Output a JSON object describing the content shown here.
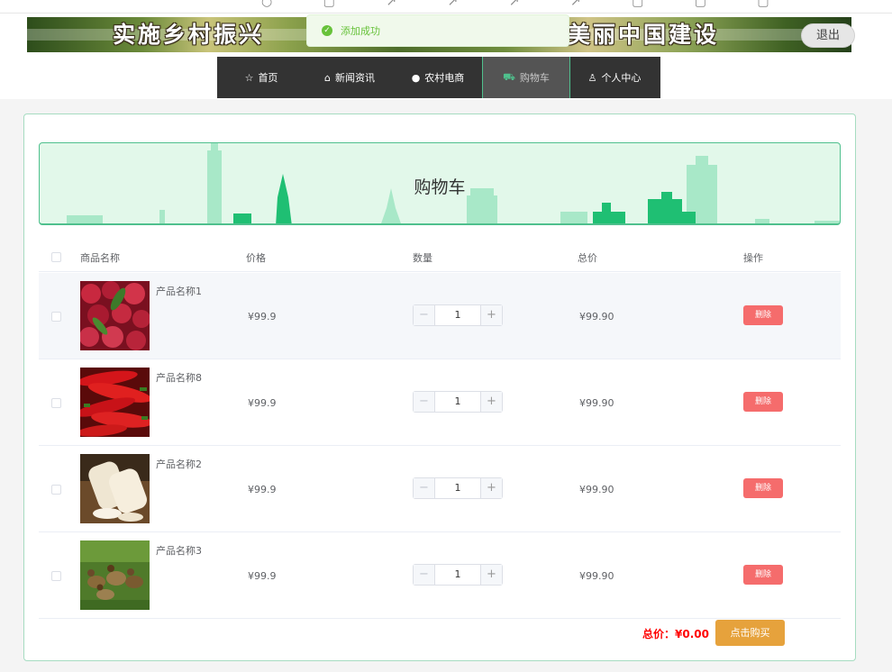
{
  "browser": {
    "icons": [
      "search-icon",
      "file-icon",
      "arrow-icon",
      "arrow-icon",
      "arrow-icon",
      "arrow-icon",
      "file-icon",
      "file-icon",
      "file-icon"
    ]
  },
  "header": {
    "banner_left": "实施乡村振兴",
    "banner_right": "美丽中国建设",
    "logout_label": "退出"
  },
  "toast": {
    "message": "添加成功"
  },
  "nav": {
    "items": [
      {
        "label": "首页",
        "icon": "star-icon"
      },
      {
        "label": "新闻资讯",
        "icon": "home-icon"
      },
      {
        "label": "农村电商",
        "icon": "info-icon"
      },
      {
        "label": "购物车",
        "icon": "cart-icon"
      },
      {
        "label": "个人中心",
        "icon": "user-icon"
      }
    ],
    "active_index": 3
  },
  "page": {
    "title": "购物车"
  },
  "table": {
    "headers": {
      "name": "商品名称",
      "price": "价格",
      "quantity": "数量",
      "total": "总价",
      "action": "操作"
    },
    "rows": [
      {
        "name": "产品名称1",
        "price": "¥99.9",
        "quantity": "1",
        "total": "¥99.90",
        "delete_label": "删除",
        "image": "bayberry"
      },
      {
        "name": "产品名称8",
        "price": "¥99.9",
        "quantity": "1",
        "total": "¥99.90",
        "delete_label": "删除",
        "image": "chili-pepper"
      },
      {
        "name": "产品名称2",
        "price": "¥99.9",
        "quantity": "1",
        "total": "¥99.90",
        "delete_label": "删除",
        "image": "yam"
      },
      {
        "name": "产品名称3",
        "price": "¥99.9",
        "quantity": "1",
        "total": "¥99.90",
        "delete_label": "删除",
        "image": "ducks"
      }
    ]
  },
  "summary": {
    "total_label": "总价：",
    "total_value": "¥0.00",
    "buy_label": "点击购买"
  },
  "colors": {
    "accent": "#4fc08d",
    "danger": "#f56c6c",
    "warning": "#e6a23c",
    "success": "#67c23a",
    "price_red": "#ff0000"
  }
}
